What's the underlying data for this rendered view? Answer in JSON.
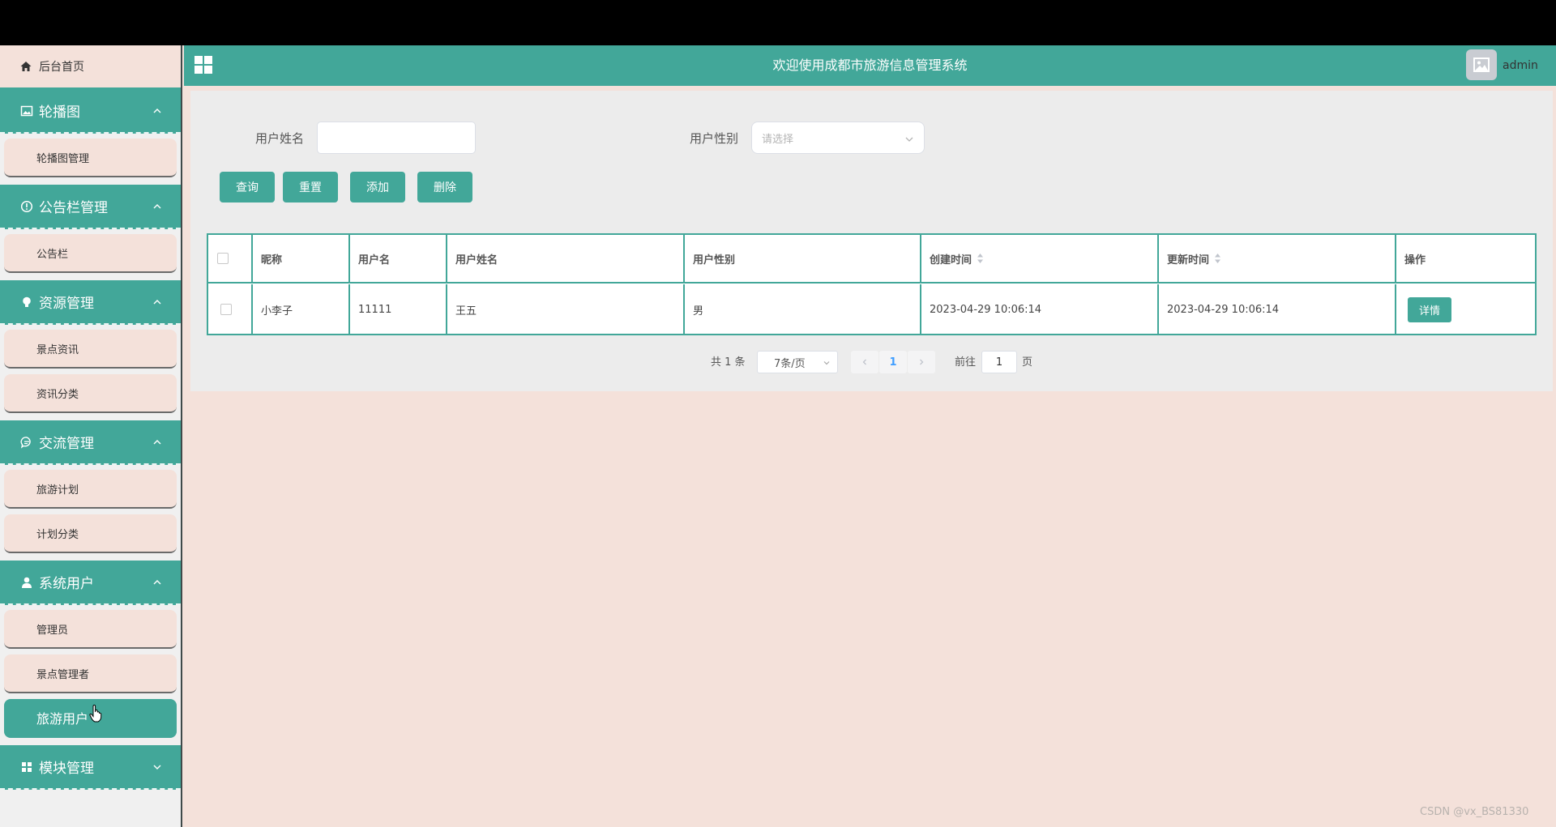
{
  "header": {
    "title": "欢迎使用成都市旅游信息管理系统",
    "user": "admin"
  },
  "sidebar": {
    "home": "后台首页",
    "groups": [
      {
        "label": "轮播图",
        "items": [
          "轮播图管理"
        ]
      },
      {
        "label": "公告栏管理",
        "items": [
          "公告栏"
        ]
      },
      {
        "label": "资源管理",
        "items": [
          "景点资讯",
          "资讯分类"
        ]
      },
      {
        "label": "交流管理",
        "items": [
          "旅游计划",
          "计划分类"
        ]
      },
      {
        "label": "系统用户",
        "items": [
          "管理员",
          "景点管理者",
          "旅游用户"
        ]
      },
      {
        "label": "模块管理",
        "items": []
      }
    ],
    "active_item": "旅游用户"
  },
  "search": {
    "name_label": "用户姓名",
    "name_value": "",
    "gender_label": "用户性别",
    "gender_placeholder": "请选择"
  },
  "buttons": {
    "query": "查询",
    "reset": "重置",
    "add": "添加",
    "delete": "删除"
  },
  "table": {
    "headers": [
      "昵称",
      "用户名",
      "用户姓名",
      "用户性别",
      "创建时间",
      "更新时间",
      "操作"
    ],
    "rows": [
      {
        "nickname": "小李子",
        "username": "11111",
        "realname": "王五",
        "gender": "男",
        "created": "2023-04-29 10:06:14",
        "updated": "2023-04-29 10:06:14",
        "action": "详情"
      }
    ]
  },
  "pagination": {
    "total": "共 1 条",
    "page_size": "7条/页",
    "current_page": "1",
    "goto_label": "前往",
    "goto_value": "1",
    "page_suffix": "页"
  },
  "watermark": "CSDN @vx_BS81330",
  "colors": {
    "accent": "#42a799",
    "background": "#f4e1da"
  }
}
